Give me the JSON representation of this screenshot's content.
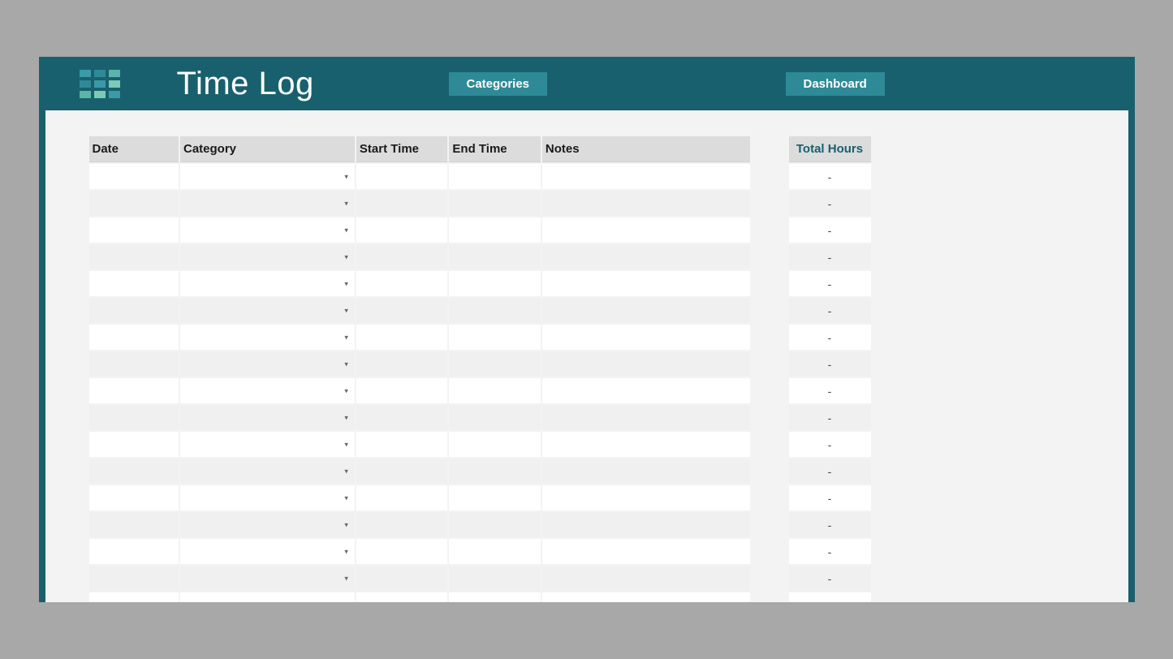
{
  "header": {
    "title": "Time Log",
    "nav": {
      "categories": "Categories",
      "dashboard": "Dashboard"
    }
  },
  "main_table": {
    "columns": {
      "date": "Date",
      "category": "Category",
      "start_time": "Start Time",
      "end_time": "End Time",
      "notes": "Notes"
    },
    "rows": [
      {
        "date": "",
        "category": "",
        "start_time": "",
        "end_time": "",
        "notes": ""
      },
      {
        "date": "",
        "category": "",
        "start_time": "",
        "end_time": "",
        "notes": ""
      },
      {
        "date": "",
        "category": "",
        "start_time": "",
        "end_time": "",
        "notes": ""
      },
      {
        "date": "",
        "category": "",
        "start_time": "",
        "end_time": "",
        "notes": ""
      },
      {
        "date": "",
        "category": "",
        "start_time": "",
        "end_time": "",
        "notes": ""
      },
      {
        "date": "",
        "category": "",
        "start_time": "",
        "end_time": "",
        "notes": ""
      },
      {
        "date": "",
        "category": "",
        "start_time": "",
        "end_time": "",
        "notes": ""
      },
      {
        "date": "",
        "category": "",
        "start_time": "",
        "end_time": "",
        "notes": ""
      },
      {
        "date": "",
        "category": "",
        "start_time": "",
        "end_time": "",
        "notes": ""
      },
      {
        "date": "",
        "category": "",
        "start_time": "",
        "end_time": "",
        "notes": ""
      },
      {
        "date": "",
        "category": "",
        "start_time": "",
        "end_time": "",
        "notes": ""
      },
      {
        "date": "",
        "category": "",
        "start_time": "",
        "end_time": "",
        "notes": ""
      },
      {
        "date": "",
        "category": "",
        "start_time": "",
        "end_time": "",
        "notes": ""
      },
      {
        "date": "",
        "category": "",
        "start_time": "",
        "end_time": "",
        "notes": ""
      },
      {
        "date": "",
        "category": "",
        "start_time": "",
        "end_time": "",
        "notes": ""
      },
      {
        "date": "",
        "category": "",
        "start_time": "",
        "end_time": "",
        "notes": ""
      },
      {
        "date": "",
        "category": "",
        "start_time": "",
        "end_time": "",
        "notes": ""
      },
      {
        "date": "",
        "category": "",
        "start_time": "",
        "end_time": "",
        "notes": ""
      }
    ]
  },
  "totals_table": {
    "header": "Total Hours",
    "rows": [
      "-",
      "-",
      "-",
      "-",
      "-",
      "-",
      "-",
      "-",
      "-",
      "-",
      "-",
      "-",
      "-",
      "-",
      "-",
      "-",
      "-",
      "-"
    ]
  }
}
